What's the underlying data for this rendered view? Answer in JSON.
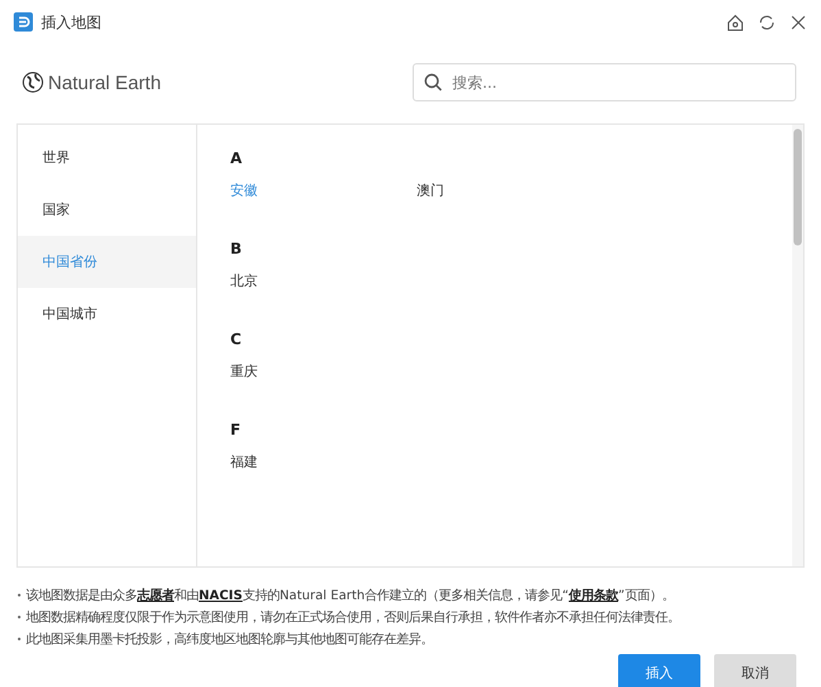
{
  "window": {
    "title": "插入地图"
  },
  "logo": {
    "text": "Natural Earth"
  },
  "search": {
    "placeholder": "搜索..."
  },
  "sidebar": {
    "items": [
      {
        "label": "世界",
        "selected": false
      },
      {
        "label": "国家",
        "selected": false
      },
      {
        "label": "中国省份",
        "selected": true
      },
      {
        "label": "中国城市",
        "selected": false
      }
    ]
  },
  "groups": [
    {
      "letter": "A",
      "items": [
        {
          "label": "安徽",
          "selected": true
        },
        {
          "label": "澳门",
          "selected": false
        }
      ]
    },
    {
      "letter": "B",
      "items": [
        {
          "label": "北京",
          "selected": false
        }
      ]
    },
    {
      "letter": "C",
      "items": [
        {
          "label": "重庆",
          "selected": false
        }
      ]
    },
    {
      "letter": "F",
      "items": [
        {
          "label": "福建",
          "selected": false
        }
      ]
    }
  ],
  "notes": [
    [
      {
        "text": "该地图数据是由众多"
      },
      {
        "text": "志愿者",
        "link": true
      },
      {
        "text": "和由"
      },
      {
        "text": "NACIS",
        "link": true
      },
      {
        "text": "支持的Natural Earth合作建立的（更多相关信息，请参见“"
      },
      {
        "text": "使用条款",
        "link": true
      },
      {
        "text": "”页面）。"
      }
    ],
    [
      {
        "text": "地图数据精确程度仅限于作为示意图使用，请勿在正式场合使用，否则后果自行承担，软件作者亦不承担任何法律责任。"
      }
    ],
    [
      {
        "text": "此地图采集用墨卡托投影，高纬度地区地图轮廓与其他地图可能存在差异。"
      }
    ]
  ],
  "buttons": [
    {
      "label": "插入",
      "kind": "primary"
    },
    {
      "label": "取消",
      "kind": "secondary"
    }
  ]
}
